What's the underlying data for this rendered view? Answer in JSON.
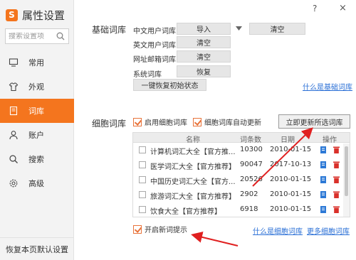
{
  "app": {
    "title": "属性设置"
  },
  "search": {
    "placeholder": "搜索设置项"
  },
  "sidebar": {
    "items": [
      {
        "label": "常用"
      },
      {
        "label": "外观"
      },
      {
        "label": "词库"
      },
      {
        "label": "账户"
      },
      {
        "label": "搜索"
      },
      {
        "label": "高级"
      }
    ],
    "active_index": 2,
    "restore_label": "恢复本页默认设置"
  },
  "window": {
    "help": "?",
    "close": "×"
  },
  "basic": {
    "title": "基础词库",
    "rows": [
      {
        "label": "中文用户词库",
        "buttons": [
          "导入",
          "清空"
        ]
      },
      {
        "label": "英文用户词库",
        "buttons": [
          "清空"
        ]
      },
      {
        "label": "网址邮箱词库",
        "buttons": [
          "清空"
        ]
      },
      {
        "label": "系统词库",
        "buttons": [
          "恢复"
        ]
      }
    ],
    "reset_button": "一键恢复初始状态",
    "link": "什么是基础词库"
  },
  "cell": {
    "title": "细胞词库",
    "enable_label": "启用细胞词库",
    "auto_update_label": "细胞词库自动更新",
    "update_button": "立即更新所选词库",
    "columns": [
      "名称",
      "词条数",
      "日期",
      "操作"
    ],
    "rows": [
      {
        "name": "计算机词汇大全【官方推...",
        "count": "10300",
        "date": "2010-01-15"
      },
      {
        "name": "医学词汇大全【官方推荐】",
        "count": "90047",
        "date": "2017-10-13"
      },
      {
        "name": "中国历史词汇大全【官方...",
        "count": "20526",
        "date": "2010-01-15"
      },
      {
        "name": "旅游词汇大全【官方推荐】",
        "count": "2902",
        "date": "2010-01-15"
      },
      {
        "name": "饮食大全【官方推荐】",
        "count": "6918",
        "date": "2010-01-15"
      }
    ],
    "new_tip_label": "开启新词提示",
    "link_what": "什么是细胞词库",
    "link_more": "更多细胞词库"
  },
  "colors": {
    "accent": "#f4751e",
    "link": "#2a6fd6",
    "arrow": "#e02020",
    "icon_blue": "#2e7ad6",
    "icon_red": "#d9302a"
  }
}
